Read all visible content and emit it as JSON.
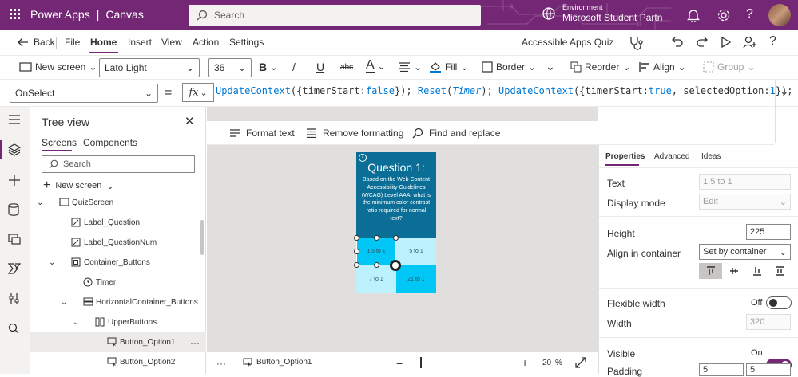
{
  "app": {
    "brand": "Power Apps",
    "mode": "Canvas",
    "separator": "|"
  },
  "search": {
    "placeholder": "Search"
  },
  "environment": {
    "label": "Environment",
    "value": "Microsoft Student Partn"
  },
  "menu": {
    "back": "Back",
    "items": [
      "File",
      "Home",
      "Insert",
      "View",
      "Action",
      "Settings"
    ],
    "active": "Home",
    "app_name": "Accessible Apps Quiz"
  },
  "toolbar": {
    "new_screen": "New screen",
    "font": "Lato Light",
    "size": "36",
    "bold": "B",
    "italic": "/",
    "underline": "U",
    "strike": "abc",
    "font_color": "A",
    "fill": "Fill",
    "border": "Border",
    "reorder": "Reorder",
    "align": "Align",
    "group": "Group"
  },
  "formula": {
    "property": "OnSelect",
    "eq": "=",
    "fx": "fx",
    "parts": [
      {
        "t": "UpdateContext",
        "c": "fn"
      },
      {
        "t": "({timerStart:",
        "c": "p"
      },
      {
        "t": "false",
        "c": "kw"
      },
      {
        "t": "}); ",
        "c": "p"
      },
      {
        "t": "Reset",
        "c": "fn"
      },
      {
        "t": "(",
        "c": "p"
      },
      {
        "t": "Timer",
        "c": "it"
      },
      {
        "t": "); ",
        "c": "p"
      },
      {
        "t": "UpdateContext",
        "c": "fn"
      },
      {
        "t": "({timerStart:",
        "c": "p"
      },
      {
        "t": "true",
        "c": "kw"
      },
      {
        "t": ", selectedOption:",
        "c": "p"
      },
      {
        "t": "1",
        "c": "kw"
      },
      {
        "t": "});",
        "c": "p"
      }
    ]
  },
  "tree": {
    "title": "Tree view",
    "tabs": [
      "Screens",
      "Components"
    ],
    "search_placeholder": "Search",
    "new_screen": "New screen",
    "items": [
      {
        "label": "QuizScreen",
        "indent": 0,
        "icon": "screen"
      },
      {
        "label": "Label_Question",
        "indent": 1,
        "icon": "label"
      },
      {
        "label": "Label_QuestionNum",
        "indent": 1,
        "icon": "label"
      },
      {
        "label": "Container_Buttons",
        "indent": 1,
        "icon": "container"
      },
      {
        "label": "Timer",
        "indent": 2,
        "icon": "timer"
      },
      {
        "label": "HorizontalContainer_Buttons",
        "indent": 2,
        "icon": "hcontainer"
      },
      {
        "label": "UpperButtons",
        "indent": 3,
        "icon": "vcontainer"
      },
      {
        "label": "Button_Option1",
        "indent": 4,
        "icon": "button",
        "selected": true,
        "more": "···"
      },
      {
        "label": "Button_Option2",
        "indent": 4,
        "icon": "button"
      }
    ]
  },
  "format_bar": {
    "format_text": "Format text",
    "remove_formatting": "Remove formatting",
    "find_replace": "Find and replace"
  },
  "quiz": {
    "title": "Question 1:",
    "question": "Based on the Web Content Accessibility Guidelines (WCAG) Level AAA, what is the minimum color contrast ratio required for normal text?",
    "options": [
      "1.5 to 1",
      "5 to 1",
      "7 to 1",
      "21 to 1"
    ]
  },
  "props": {
    "tabs": [
      "Properties",
      "Advanced",
      "Ideas"
    ],
    "text_label": "Text",
    "text_value": "1.5 to 1",
    "display_mode_label": "Display mode",
    "display_mode_value": "Edit",
    "height_label": "Height",
    "height_value": "225",
    "align_label": "Align in container",
    "align_value": "Set by container",
    "flex_label": "Flexible width",
    "flex_state": "Off",
    "width_label": "Width",
    "width_value": "320",
    "visible_label": "Visible",
    "visible_state": "On",
    "padding_label": "Padding",
    "padding_values": [
      "5",
      "5"
    ]
  },
  "status": {
    "more": "···",
    "selected": "Button_Option1",
    "minus": "−",
    "plus": "+",
    "zoom": "20",
    "pct": "%"
  },
  "colors": {
    "brand": "#742774",
    "accent": "#0078d4",
    "quiz_header": "#0a6e96",
    "option_a": "#00c7f5",
    "option_b": "#bdf1fd"
  }
}
